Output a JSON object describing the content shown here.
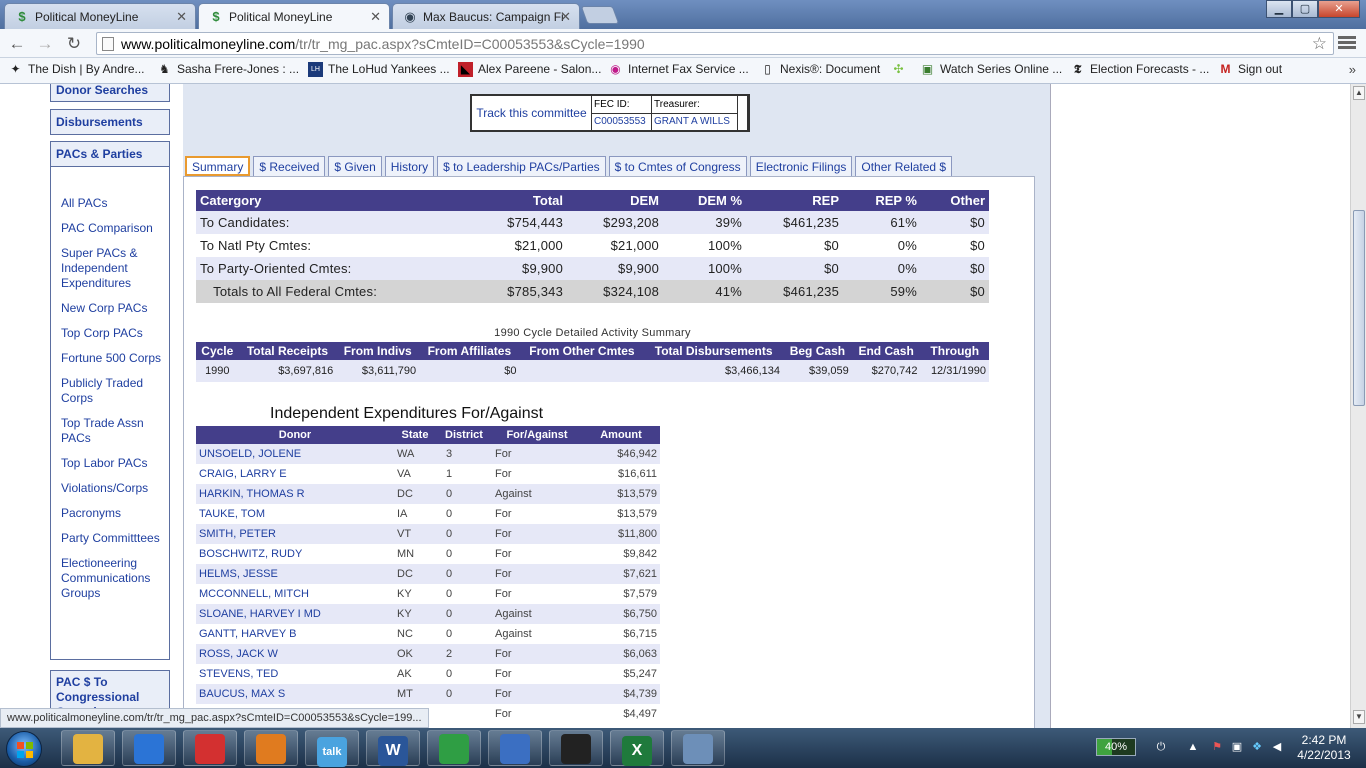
{
  "browser": {
    "tabs": [
      {
        "title": "Political MoneyLine",
        "icon": "dollar-icon",
        "active": false
      },
      {
        "title": "Political MoneyLine",
        "icon": "dollar-icon",
        "active": true
      },
      {
        "title": "Max Baucus: Campaign Fi",
        "icon": "eye-icon",
        "active": false
      }
    ],
    "url_host": "www.politicalmoneyline.com",
    "url_path": "/tr/tr_mg_pac.aspx?sCmteID=C00053553&sCycle=1990",
    "bookmarks": [
      {
        "label": "The Dish | By Andre...",
        "icon": "dish-icon"
      },
      {
        "label": "Sasha Frere-Jones : ...",
        "icon": "person-icon"
      },
      {
        "label": "The LoHud Yankees ...",
        "icon": "lohud-icon"
      },
      {
        "label": "Alex Pareene - Salon...",
        "icon": "salon-icon"
      },
      {
        "label": "Internet Fax Service ...",
        "icon": "fax-icon"
      },
      {
        "label": "Nexis®: Document",
        "icon": "document-icon"
      },
      {
        "label": "Watch Series Online ...",
        "icon": "series-icon"
      },
      {
        "label": "Election Forecasts - ...",
        "icon": "nyt-icon"
      },
      {
        "label": "Sign out",
        "icon": "gmail-icon"
      }
    ],
    "status_url": "www.politicalmoneyline.com/tr/tr_mg_pac.aspx?sCmteID=C00053553&sCycle=199..."
  },
  "sidebar": {
    "top_links": [
      "Donor Searches",
      "Disbursements",
      "PACs & Parties"
    ],
    "items": [
      "All PACs",
      "PAC Comparison",
      "Super PACs & Independent Expenditures",
      "New Corp PACs",
      "Top Corp PACs",
      "Fortune 500 Corps",
      "Publicly Traded Corps",
      "Top Trade Assn PACs",
      "Top Labor PACs",
      "Violations/Corps",
      "Pacronyms",
      "Party Committtees",
      "Electioneering Communications Groups"
    ],
    "bottom_link": "PAC $ To Congressional Committees"
  },
  "committee": {
    "track_label": "Track this committee",
    "fec_label": "FEC ID:",
    "fec_id": "C00053553",
    "treasurer_label": "Treasurer:",
    "treasurer": "GRANT A WILLS"
  },
  "page_tabs": [
    {
      "label": "Summary",
      "active": true
    },
    {
      "label": "$ Received",
      "active": false
    },
    {
      "label": "$ Given",
      "active": false
    },
    {
      "label": "History",
      "active": false
    },
    {
      "label": "$ to Leadership PACs/Parties",
      "active": false
    },
    {
      "label": "$ to Cmtes of Congress",
      "active": false
    },
    {
      "label": "Electronic Filings",
      "active": false
    },
    {
      "label": "Other Related $",
      "active": false
    }
  ],
  "summary": {
    "headers": [
      "Catergory",
      "Total",
      "DEM",
      "DEM %",
      "REP",
      "REP %",
      "Other"
    ],
    "rows": [
      [
        "To Candidates:",
        "$754,443",
        "$293,208",
        "39%",
        "$461,235",
        "61%",
        "$0"
      ],
      [
        "To Natl Pty Cmtes:",
        "$21,000",
        "$21,000",
        "100%",
        "$0",
        "0%",
        "$0"
      ],
      [
        "To Party-Oriented Cmtes:",
        "$9,900",
        "$9,900",
        "100%",
        "$0",
        "0%",
        "$0"
      ]
    ],
    "total_row": [
      "Totals to All Federal Cmtes:",
      "$785,343",
      "$324,108",
      "41%",
      "$461,235",
      "59%",
      "$0"
    ]
  },
  "detail": {
    "title": "1990 Cycle Detailed Activity Summary",
    "headers": [
      "Cycle",
      "Total Receipts",
      "From Indivs",
      "From Affiliates",
      "From Other Cmtes",
      "Total Disbursements",
      "Beg Cash",
      "End Cash",
      "Through"
    ],
    "row": [
      "1990",
      "$3,697,816",
      "$3,611,790",
      "$0",
      "",
      "$3,466,134",
      "$39,059",
      "$270,742",
      "12/31/1990"
    ]
  },
  "ie": {
    "title": "Independent Expenditures For/Against",
    "headers": [
      "Donor",
      "State",
      "District",
      "For/Against",
      "Amount"
    ],
    "rows": [
      [
        "UNSOELD, JOLENE",
        "WA",
        "3",
        "For",
        "$46,942"
      ],
      [
        "CRAIG, LARRY E",
        "VA",
        "1",
        "For",
        "$16,611"
      ],
      [
        "HARKIN, THOMAS R",
        "DC",
        "0",
        "Against",
        "$13,579"
      ],
      [
        "TAUKE, TOM",
        "IA",
        "0",
        "For",
        "$13,579"
      ],
      [
        "SMITH, PETER",
        "VT",
        "0",
        "For",
        "$11,800"
      ],
      [
        "BOSCHWITZ, RUDY",
        "MN",
        "0",
        "For",
        "$9,842"
      ],
      [
        "HELMS, JESSE",
        "DC",
        "0",
        "For",
        "$7,621"
      ],
      [
        "MCCONNELL, MITCH",
        "KY",
        "0",
        "For",
        "$7,579"
      ],
      [
        "SLOANE, HARVEY I MD",
        "KY",
        "0",
        "Against",
        "$6,750"
      ],
      [
        "GANTT, HARVEY B",
        "NC",
        "0",
        "Against",
        "$6,715"
      ],
      [
        "ROSS, JACK W",
        "OK",
        "2",
        "For",
        "$6,063"
      ],
      [
        "STEVENS, TED",
        "AK",
        "0",
        "For",
        "$5,247"
      ],
      [
        "BAUCUS, MAX S",
        "MT",
        "0",
        "For",
        "$4,739"
      ],
      [
        "",
        "",
        "",
        "For",
        "$4,497"
      ]
    ]
  },
  "taskbar": {
    "apps": [
      {
        "icon": "explorer-icon",
        "color": "#e3b341"
      },
      {
        "icon": "ie-icon",
        "color": "#2b74d6"
      },
      {
        "icon": "plus-app-icon",
        "color": "#d33030"
      },
      {
        "icon": "media-icon",
        "color": "#e07b1f"
      },
      {
        "icon": "talk-icon",
        "color": "#4aa3df",
        "label": "talk"
      },
      {
        "icon": "word-icon",
        "color": "#2a5699",
        "label": "W"
      },
      {
        "icon": "chrome-icon",
        "color": "#2f9e44"
      },
      {
        "icon": "security-icon",
        "color": "#3b6fc2"
      },
      {
        "icon": "terminal-icon",
        "color": "#222222"
      },
      {
        "icon": "excel-icon",
        "color": "#1f7a3c",
        "label": "X"
      },
      {
        "icon": "calculator-icon",
        "color": "#6d8fb8"
      }
    ],
    "battery": "40%",
    "battery_level": 0.4,
    "time": "2:42 PM",
    "date": "4/22/2013"
  }
}
